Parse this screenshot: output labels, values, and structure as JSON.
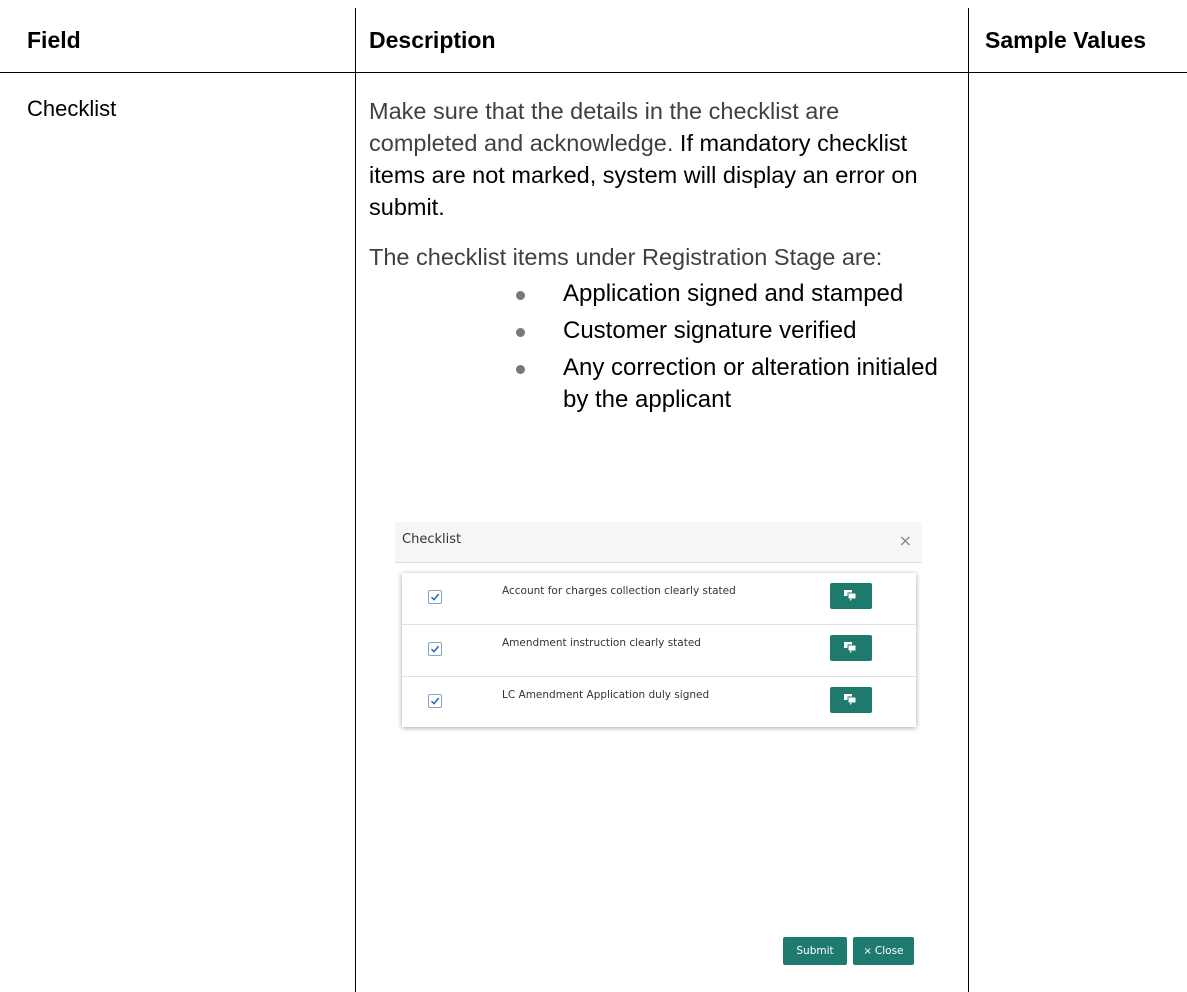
{
  "table": {
    "headers": [
      "Field",
      "Description",
      "Sample Values"
    ],
    "rows": [
      {
        "field": "Checklist",
        "description": {
          "p1_gray": "Make sure that the details in the checklist are completed and acknowledge.",
          "p1_black": " If mandatory checklist items are not marked, system will display an error on submit.",
          "p2": "The checklist items under Registration Stage are:",
          "bullets": [
            "Application signed and stamped",
            "Customer signature verified",
            "Any correction or alteration initialed by the applicant"
          ]
        },
        "sample_values": ""
      }
    ]
  },
  "checklist_window": {
    "title": "Checklist",
    "close_icon": "×",
    "items": [
      {
        "label": "Account for charges collection clearly stated",
        "checked": true
      },
      {
        "label": "Amendment instruction clearly stated",
        "checked": true
      },
      {
        "label": "LC Amendment Application duly signed",
        "checked": true
      }
    ],
    "item_button_icon": "comment-icon",
    "submit_label": "Submit",
    "close_label": "Close",
    "close_button_icon": "×",
    "accent_color": "#1f7a70"
  }
}
